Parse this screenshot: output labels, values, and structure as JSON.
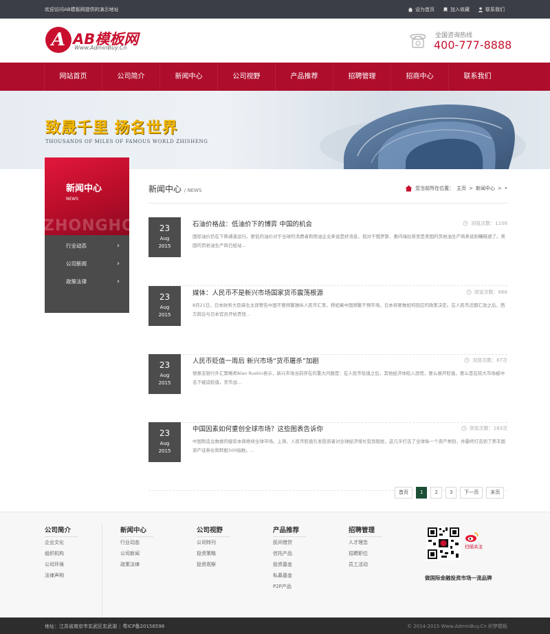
{
  "topbar": {
    "welcome": "欢迎访问AB模板网提供的演示地址",
    "links": [
      "设为首页",
      "加入收藏",
      "联系我们"
    ]
  },
  "header": {
    "logo_mark": "A",
    "logo_name": "AB模板网",
    "logo_sub": "Www.AdminBuy.Cn",
    "hotline_label": "全国咨询热线",
    "hotline_number": "400-777-8888"
  },
  "nav": [
    "网站首页",
    "公司简介",
    "新闻中心",
    "公司视野",
    "产品推荐",
    "招聘管理",
    "招商中心",
    "联系我们"
  ],
  "banner": {
    "slogan": "致晟千里  扬名世界",
    "slogan_en": "THOUSANDS OF MILES OF FAMOUS WORLD ZHISHENG"
  },
  "sidebar": {
    "title": "新闻中心",
    "title_en": "NEWS",
    "watermark": "ZHONGHO",
    "items": [
      "行业动态",
      "公司新闻",
      "政策法律"
    ]
  },
  "main": {
    "title": "新闻中心",
    "title_en": "NEWS",
    "breadcrumb_prefix": "您当前所在位置：",
    "breadcrumb": [
      "主页",
      "新闻中心"
    ]
  },
  "news": [
    {
      "day": "23",
      "month": "Aug",
      "year": "2015",
      "title": "石油价格战：低油价下的博弈 中国的机会",
      "views": "浏览次数：1108",
      "desc": "国际油价仍在下降通道运行。更低的油价对于全球的消费者和用油企业来说是好消息，但对于俄罗斯、委内瑞拉甚至是美国的页岩油生产商来说则糟糕透了。美国的页岩油生产商已经站..."
    },
    {
      "day": "23",
      "month": "Aug",
      "year": "2015",
      "title": "媒体：人民币不是新兴市场国家货币震荡根源",
      "views": "浏览次数：668",
      "desc": "8月21日，日本财务大臣麻生太郎警告中国不要频繁操纵人民币汇率，称如果中国频繁干预市场，日本将要做如何回应的政策决定。在人民币近期汇改之后，西方舆论与日本官员开始责怪..."
    },
    {
      "day": "23",
      "month": "Aug",
      "year": "2015",
      "title": "人民币贬值一周后 新兴市场“货币屠杀”加剧",
      "views": "浏览次数：87次",
      "desc": "德意志银行外汇策略师Alan Ruskin表示，新兴市场当前存在的重大问题是：在人民币贬值之后，其他经济体陷入恐慌，要么展开贬值，要么是在较大市场被冲击下被迫贬值，货币战..."
    },
    {
      "day": "23",
      "month": "Aug",
      "year": "2015",
      "title": "中国因素如何重创全球市场？这些图表告诉你",
      "views": "浏览次数：183次",
      "desc": "中国制造业数据的疲软本周继续全球市场。上周，人民币贬值引发投资者对全球经济增长受到阻扰，这几乎打击了全球每一个资产类别，并最终打击到了美丰国资产证券化和转股500指数。..."
    }
  ],
  "pager": [
    "首页",
    "1",
    "2",
    "3",
    "下一页",
    "末页"
  ],
  "footer": {
    "columns": [
      {
        "title": "公司简介",
        "links": [
          "企业文化",
          "组织机构",
          "公司环境",
          "法律声明"
        ]
      },
      {
        "title": "新闻中心",
        "links": [
          "行业动态",
          "公司新闻",
          "政策法律"
        ]
      },
      {
        "title": "公司视野",
        "links": [
          "公司特刊",
          "投资策略",
          "投资观察"
        ]
      },
      {
        "title": "产品推荐",
        "links": [
          "民间借贷",
          "信托产品",
          "投资基金",
          "私募基金",
          "P2P产品"
        ]
      },
      {
        "title": "招聘管理",
        "links": [
          "人才理念",
          "招聘职位",
          "员工活动"
        ]
      }
    ],
    "weibo_label": "扫描关注",
    "slogan": "做国际金融投资市场一流品牌"
  },
  "bottombar": {
    "address": "地址：江苏省南京市玄武区玄武湖",
    "icp": "粤ICP备20156598",
    "copyright": "© 2014-2015 Www.AdminBuy.Cn 织梦模板"
  },
  "colors": {
    "brand_red": "#ae0d2b",
    "topbar": "#3b3e47",
    "date_box": "#4c4c4c",
    "pager_active": "#1c4f35"
  }
}
